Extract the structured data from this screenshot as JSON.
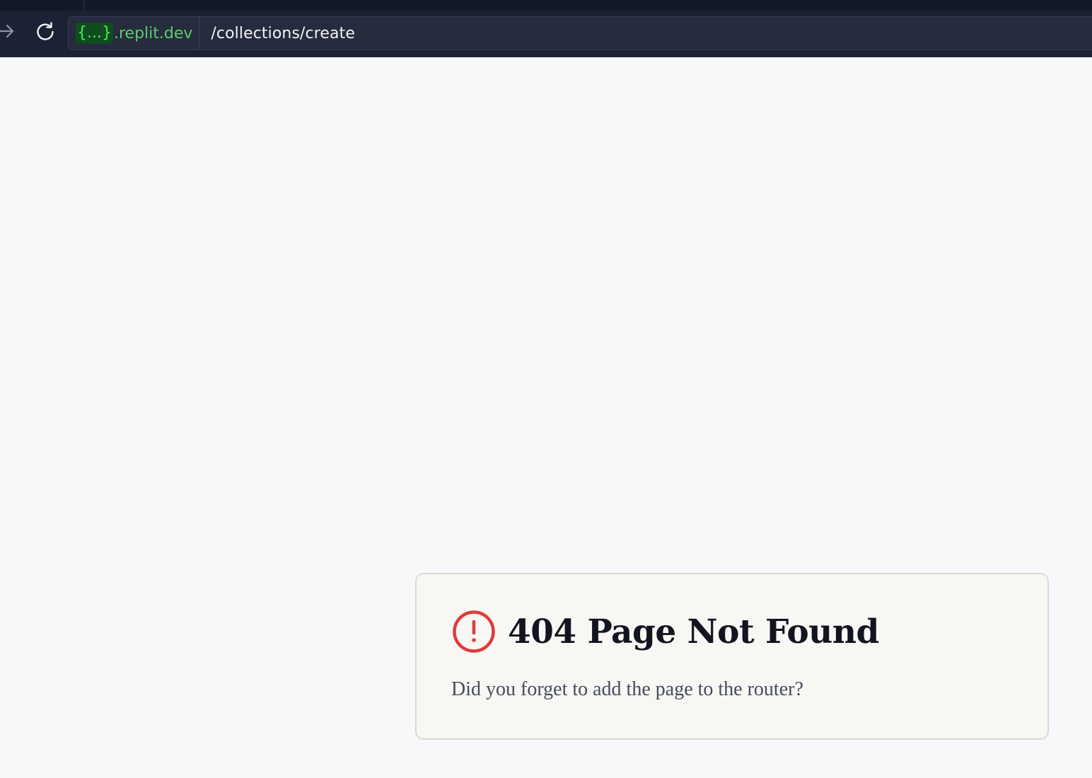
{
  "browser": {
    "address_bar": {
      "host_badge": "{...}",
      "host_domain": ".replit.dev",
      "path": "/collections/create"
    },
    "icons": {
      "forward": "arrow-right-icon",
      "reload": "reload-icon"
    },
    "colors": {
      "chrome_background": "#1c2233",
      "host_text": "#5ecb6b",
      "host_badge_background": "#0f4d1e"
    }
  },
  "error_card": {
    "icon": "alert-circle-icon",
    "title": "404 Page Not Found",
    "message": "Did you forget to add the page to the router?",
    "colors": {
      "icon": "#e03a3a",
      "title": "#12151f",
      "message": "#454c5c"
    }
  }
}
